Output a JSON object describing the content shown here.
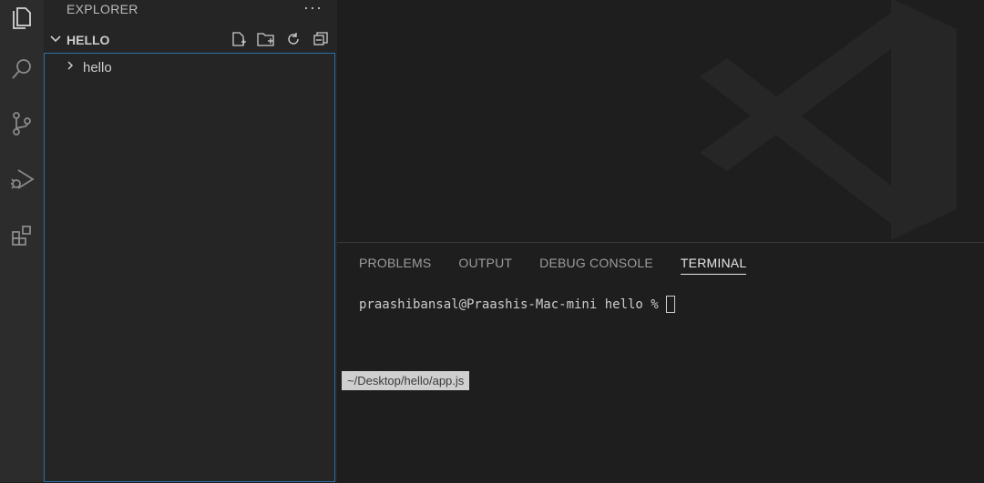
{
  "sidebar": {
    "title": "EXPLORER",
    "more_label": "···",
    "section": {
      "label": "HELLO"
    },
    "tree": [
      {
        "label": "hello"
      }
    ]
  },
  "panel": {
    "tabs": [
      {
        "label": "PROBLEMS",
        "active": false
      },
      {
        "label": "OUTPUT",
        "active": false
      },
      {
        "label": "DEBUG CONSOLE",
        "active": false
      },
      {
        "label": "TERMINAL",
        "active": true
      }
    ],
    "terminal": {
      "prompt": "praashibansal@Praashis-Mac-mini hello %"
    }
  },
  "tooltip": {
    "text": "~/Desktop/hello/app.js"
  },
  "icons": {
    "activity": [
      "files-icon",
      "search-icon",
      "source-control-icon",
      "run-debug-icon",
      "extensions-icon"
    ],
    "section_actions": [
      "new-file-icon",
      "new-folder-icon",
      "refresh-icon",
      "collapse-all-icon"
    ]
  },
  "colors": {
    "activity_bar": "#2c2c2c",
    "sidebar": "#252526",
    "editor": "#1e1e1e",
    "focus_border": "#2b6fa3",
    "tooltip_bg": "#cfcfcf"
  }
}
